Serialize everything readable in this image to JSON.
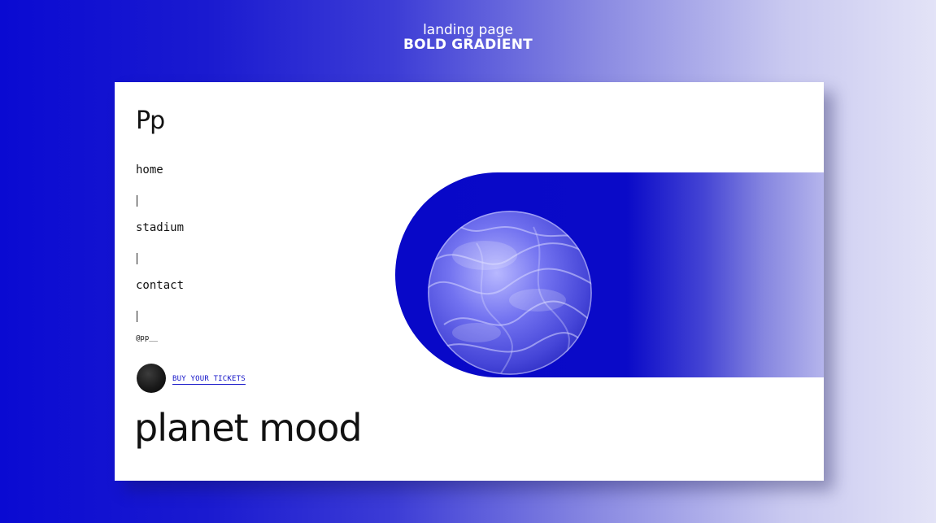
{
  "caption": {
    "subtitle": "landing page",
    "title": "BOLD GRADIENT"
  },
  "site": {
    "logo": "Pp",
    "nav": {
      "items": [
        {
          "label": "home"
        },
        {
          "label": "stadium"
        },
        {
          "label": "contact"
        }
      ],
      "separator": "|"
    },
    "handle": "@pp__",
    "cta_label": "BUY YOUR TICKETS",
    "headline": "planet mood"
  },
  "colors": {
    "accent": "#0a0ad2",
    "link": "#1414c8",
    "text": "#111111",
    "card": "#ffffff"
  },
  "icons": {
    "planet": "planet-image",
    "ticket": "black-ball-icon"
  }
}
